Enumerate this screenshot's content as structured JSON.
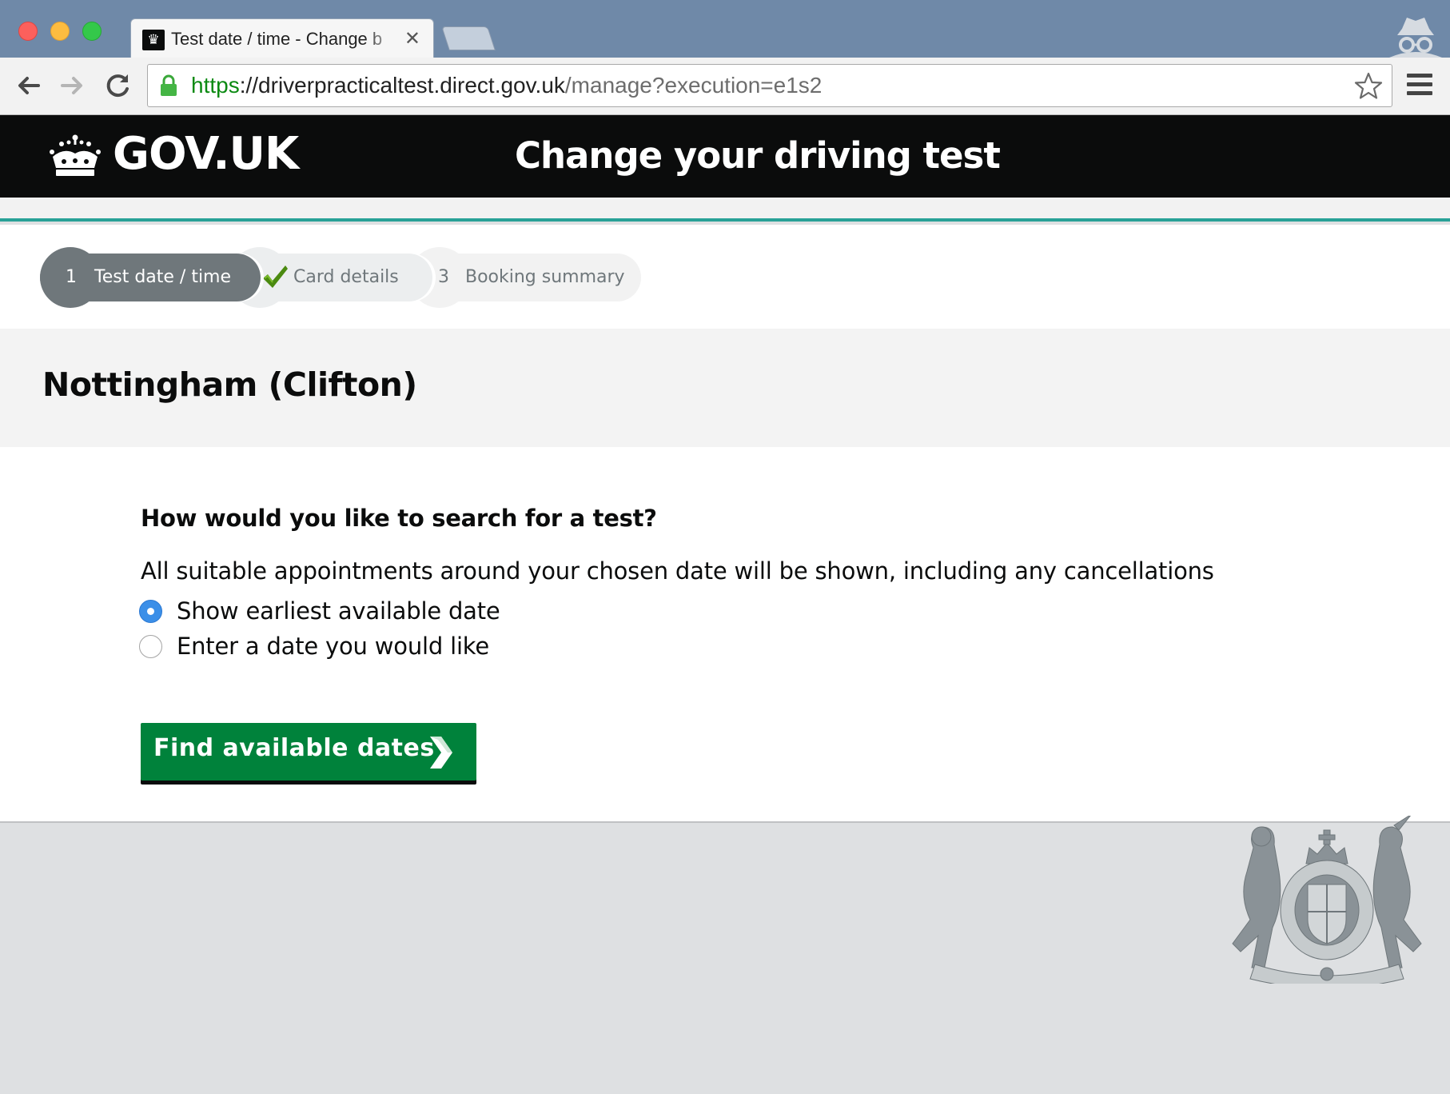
{
  "browser": {
    "tab_title": "Test date / time - Change b",
    "tab_favicon": "crown-favicon",
    "url": {
      "scheme": "https",
      "separator": "://",
      "host": "driverpracticaltest.direct.gov.uk",
      "path": "/manage?execution=e1s2"
    },
    "icons": [
      "back-arrow-icon",
      "forward-arrow-icon",
      "reload-icon",
      "lock-icon",
      "star-icon",
      "hamburger-menu-icon",
      "incognito-icon"
    ]
  },
  "header": {
    "logo_text": "GOV.UK",
    "service_name": "Change your driving test"
  },
  "steps": [
    {
      "number": "1",
      "label": "Test date / time",
      "state": "current"
    },
    {
      "number": "",
      "label": "Card details",
      "state": "complete"
    },
    {
      "number": "3",
      "label": "Booking summary",
      "state": "upcoming"
    }
  ],
  "test_centre": {
    "name": "Nottingham (Clifton)"
  },
  "form": {
    "question": "How would you like to search for a test?",
    "hint": "All suitable appointments around your chosen date will be shown, including any cancellations",
    "options": [
      {
        "label": "Show earliest available date",
        "checked": true
      },
      {
        "label": "Enter a date you would like",
        "checked": false
      }
    ],
    "submit_label": "Find available dates"
  },
  "colors": {
    "header_bg": "#0b0c0c",
    "accent_strip": "#28a197",
    "button_green": "#00823b",
    "radio_selected": "#3b8fe8",
    "step_current": "#6f777b",
    "page_bg": "#dee0e2"
  }
}
